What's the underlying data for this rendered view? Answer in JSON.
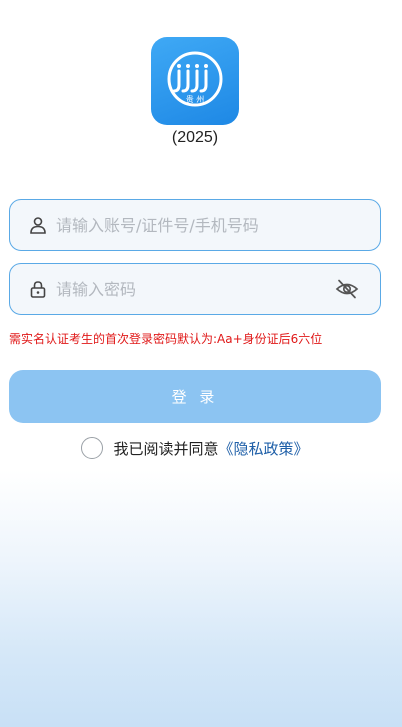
{
  "logo": {
    "caption": "贵 州",
    "colors": {
      "bg": "#1e88e5",
      "fg": "#ffffff"
    }
  },
  "version_label": "(2025)",
  "account": {
    "placeholder": "请输入账号/证件号/手机号码",
    "value": ""
  },
  "password": {
    "placeholder": "请输入密码",
    "value": ""
  },
  "notice": "需实名认证考生的首次登录密码默认为:Aa+身份证后6六位",
  "login_button": "登 录",
  "agreement": {
    "text": "我已阅读并同意",
    "link": "《隐私政策》",
    "checked": false
  },
  "colors": {
    "accent": "#5aa9e6",
    "button": "#8cc4f2",
    "warning": "#e01818",
    "link": "#1e5fa8"
  }
}
